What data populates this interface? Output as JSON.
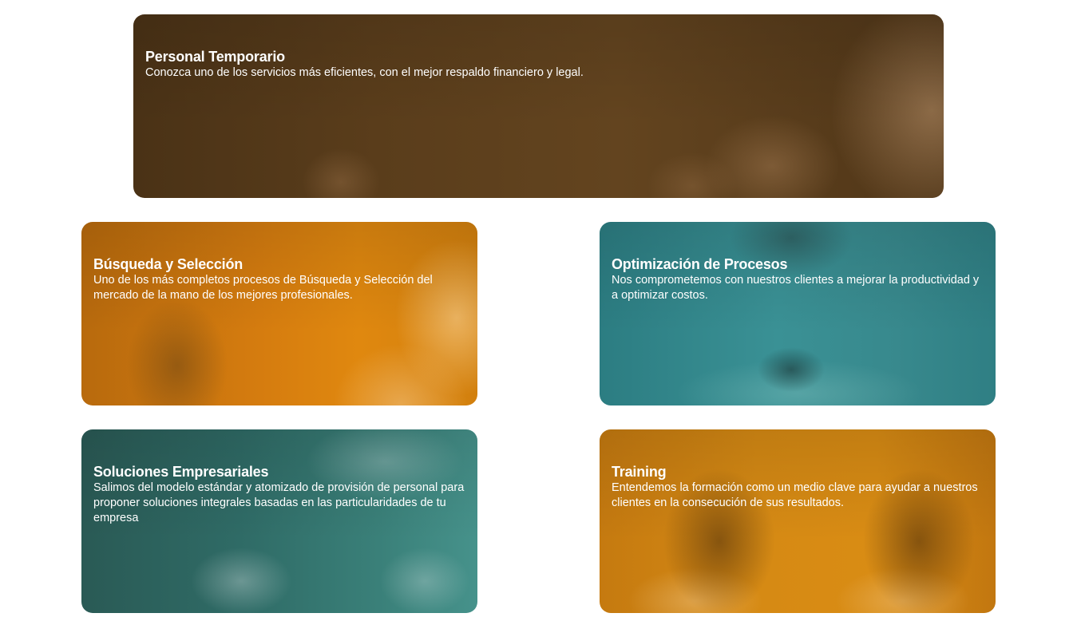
{
  "cards": [
    {
      "title": "Personal Temporario",
      "description": "Conozca uno de los servicios más eficientes, con el mejor respaldo financiero y legal."
    },
    {
      "title": "Búsqueda y Selección",
      "description": "Uno de los más completos procesos de Búsqueda y Selección del mercado de la mano de los mejores profesionales."
    },
    {
      "title": "Optimización de Procesos",
      "description": "Nos comprometemos con nuestros clientes a mejorar la productividad y a optimizar costos."
    },
    {
      "title": "Soluciones Empresariales",
      "description": "Salimos del modelo estándar y atomizado de provisión de personal para proponer soluciones integrales basadas en las particularidades de tu empresa"
    },
    {
      "title": "Training",
      "description": "Entendemos la formación como un medio clave para ayudar a nuestros clientes en la consecución de sus resultados."
    }
  ],
  "colors": {
    "overlay_brown": "#5a3d1b",
    "overlay_orange": "#d57c0f",
    "overlay_teal": "#3a9195",
    "overlay_dark_teal": "#2f6b66",
    "text": "#ffffff"
  }
}
